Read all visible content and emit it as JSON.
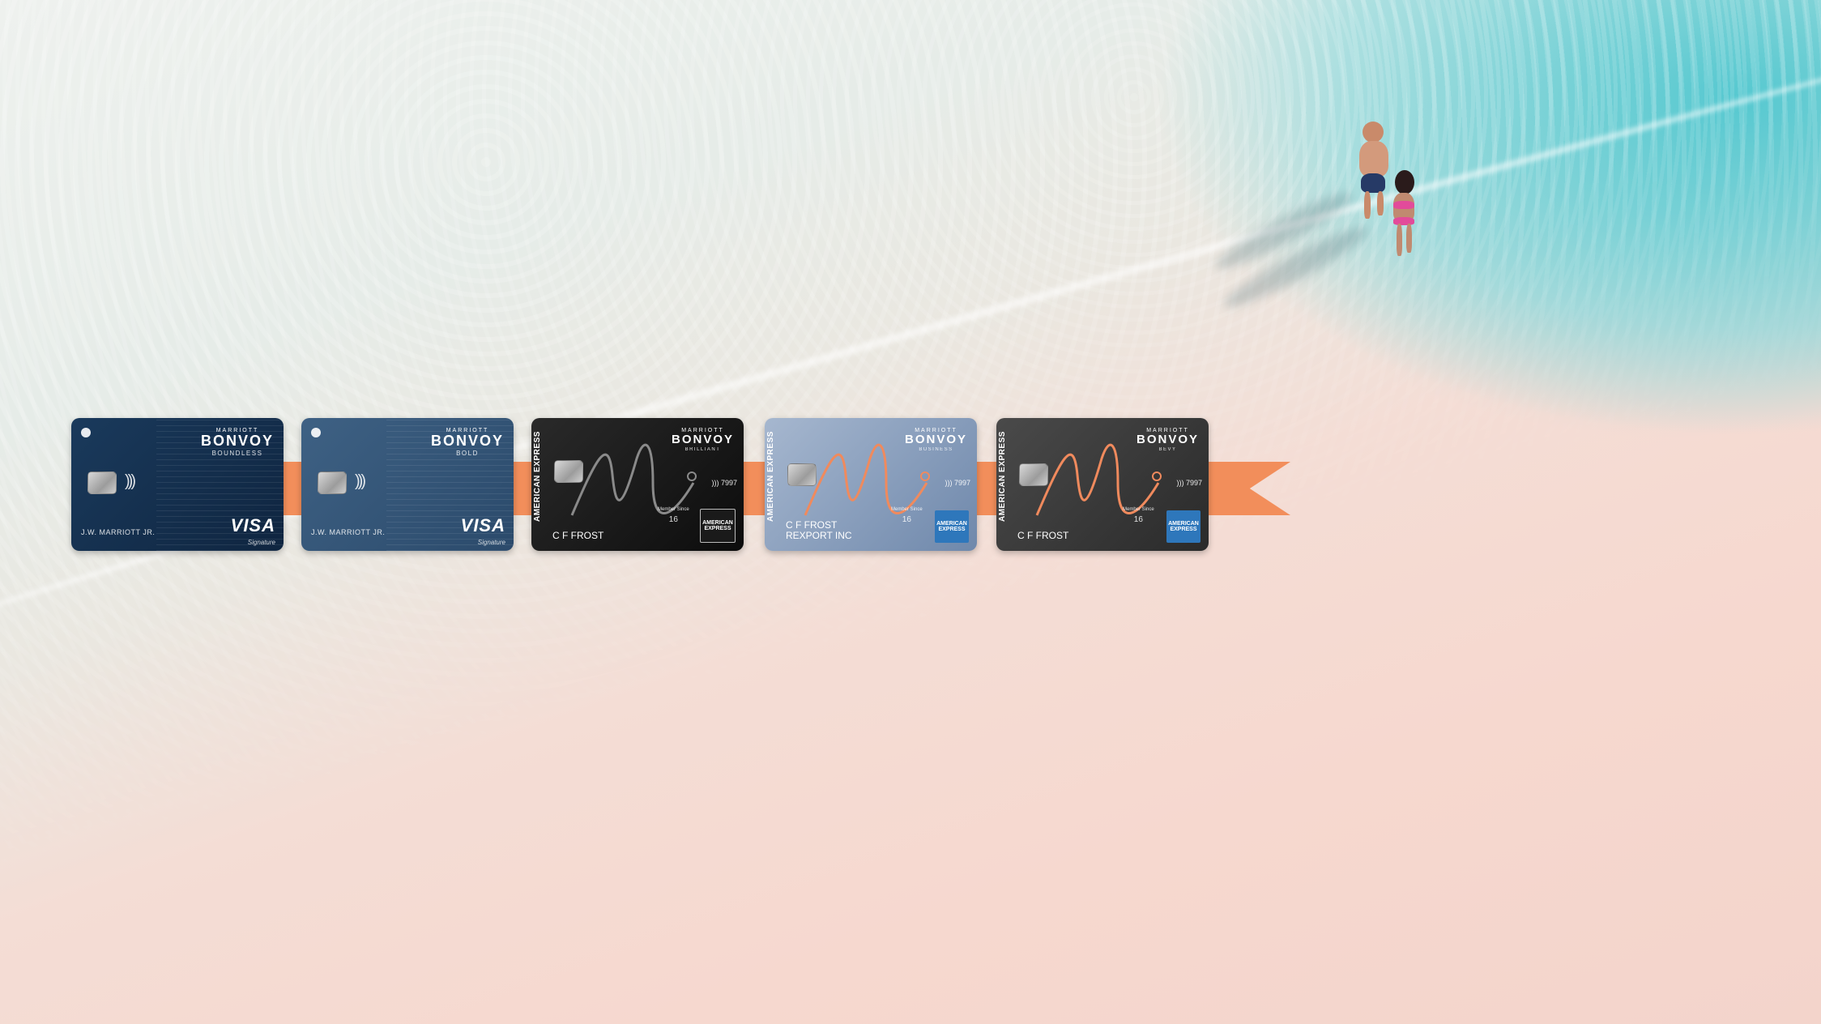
{
  "cards": [
    {
      "id": "boundless",
      "brand_top": "MARRIOTT",
      "brand_main": "BONVOY",
      "brand_sub": "BOUNDLESS",
      "holder": "J.W. MARRIOTT JR.",
      "network": "VISA",
      "network_sub": "Signature",
      "color": "#15304f"
    },
    {
      "id": "bold",
      "brand_top": "MARRIOTT",
      "brand_main": "BONVOY",
      "brand_sub": "BOLD",
      "holder": "J.W. MARRIOTT JR.",
      "network": "VISA",
      "network_sub": "Signature",
      "color": "#355677"
    },
    {
      "id": "brilliant",
      "issuer_vertical": "AMERICAN EXPRESS",
      "brand_top": "MARRIOTT",
      "brand_main": "BONVOY",
      "brand_sub": "BRILLIANT",
      "number_tail": "7997",
      "member_since_label": "Member Since",
      "member_since": "16",
      "holder": "C F FROST",
      "amex_logo": "AMERICAN EXPRESS",
      "color": "#141414",
      "accent": "#8a8a8a"
    },
    {
      "id": "business",
      "issuer_vertical": "AMERICAN EXPRESS",
      "brand_top": "MARRIOTT",
      "brand_main": "BONVOY",
      "brand_sub": "BUSINESS",
      "number_tail": "7997",
      "member_since_label": "Member Since",
      "member_since": "16",
      "holder_line1": "C F FROST",
      "holder_line2": "REXPORT INC",
      "amex_logo": "AMERICAN EXPRESS",
      "color": "#8aa0bc",
      "accent": "#f08a5d"
    },
    {
      "id": "bevy",
      "issuer_vertical": "AMERICAN EXPRESS",
      "brand_top": "MARRIOTT",
      "brand_main": "BONVOY",
      "brand_sub": "BEVY",
      "number_tail": "7997",
      "member_since_label": "Member Since",
      "member_since": "16",
      "holder": "C F FROST",
      "amex_logo": "AMERICAN EXPRESS",
      "color": "#3a3a3a",
      "accent": "#f08a5d"
    }
  ],
  "colors": {
    "ribbon": "#f28e5b",
    "ocean": "#4cc7cf",
    "sand": "#f5d9d0"
  }
}
